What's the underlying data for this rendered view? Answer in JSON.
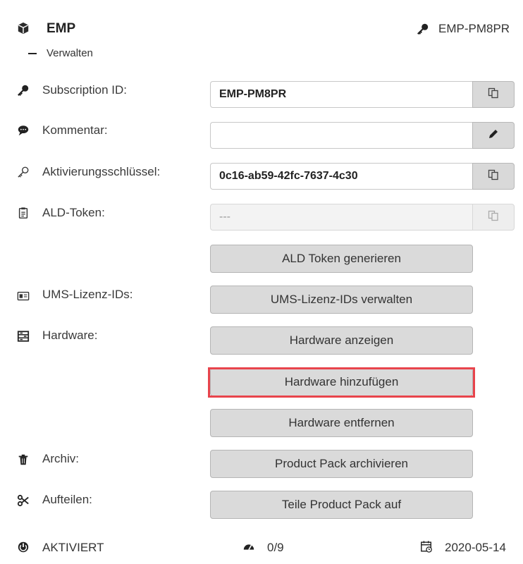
{
  "header": {
    "title": "EMP",
    "collapse_label": "Verwalten",
    "subscription_badge": "EMP-PM8PR"
  },
  "rows": {
    "subscription": {
      "label": "Subscription ID:",
      "value": "EMP-PM8PR"
    },
    "comment": {
      "label": "Kommentar:",
      "value": ""
    },
    "activation": {
      "label": "Aktivierungsschlüssel:",
      "value": "0c16-ab59-42fc-7637-4c30"
    },
    "ald": {
      "label": "ALD-Token:",
      "value": "---"
    },
    "ums": {
      "label": "UMS-Lizenz-IDs:"
    },
    "hardware": {
      "label": "Hardware:"
    },
    "archive": {
      "label": "Archiv:"
    },
    "split": {
      "label": "Aufteilen:"
    }
  },
  "buttons": {
    "ald_generate": "ALD Token generieren",
    "ums_manage": "UMS-Lizenz-IDs verwalten",
    "hw_show": "Hardware anzeigen",
    "hw_add": "Hardware hinzufügen",
    "hw_remove": "Hardware entfernen",
    "archive": "Product Pack archivieren",
    "split": "Teile Product Pack auf"
  },
  "footer": {
    "status": "AKTIVIERT",
    "usage": "0/9",
    "date": "2020-05-14"
  },
  "colors": {
    "highlight": "#e8444c",
    "button_bg": "#dadada"
  }
}
